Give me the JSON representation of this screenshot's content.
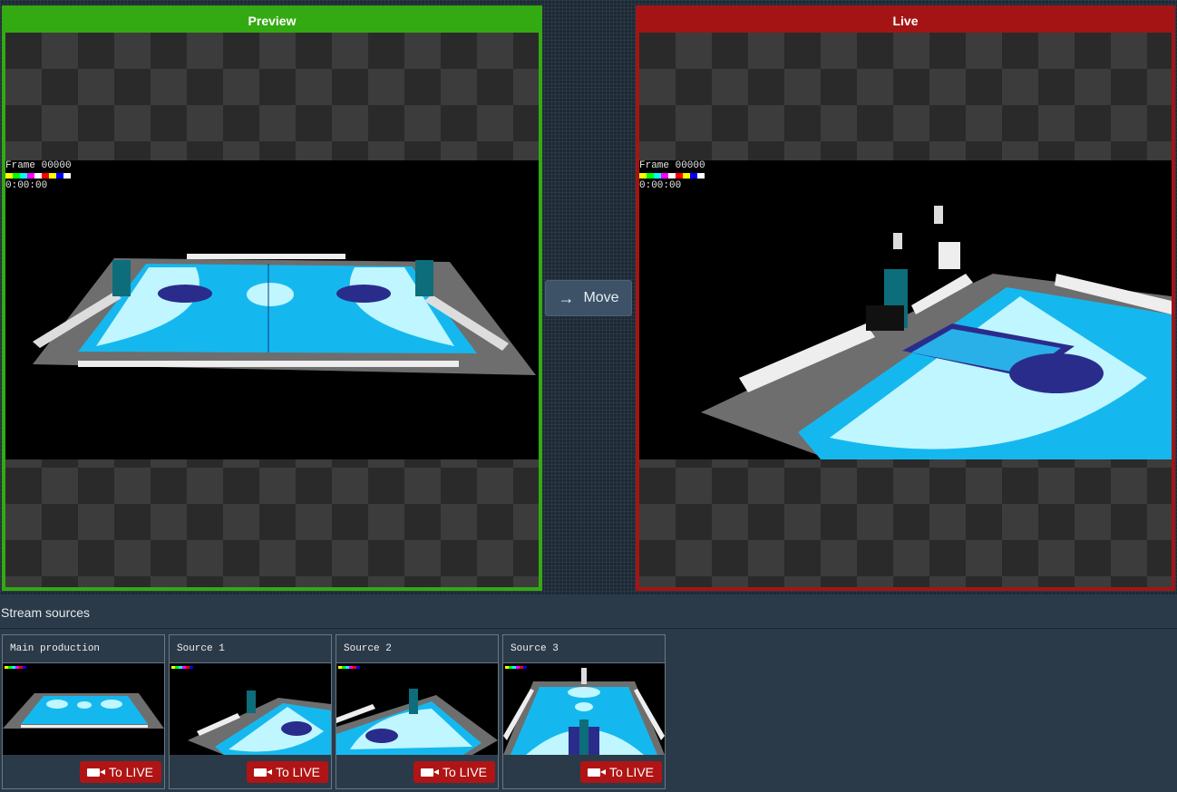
{
  "preview": {
    "label": "Preview",
    "frame_text": "Frame 00000",
    "timecode": "0:00:00"
  },
  "live": {
    "label": "Live",
    "frame_text": "Frame 00000",
    "timecode": "0:00:00"
  },
  "move_button": {
    "label": "Move",
    "icon": "arrow-right-icon"
  },
  "sources": {
    "title": "Stream sources",
    "items": [
      {
        "name": "Main production",
        "button": "To LIVE"
      },
      {
        "name": "Source 1",
        "button": "To LIVE"
      },
      {
        "name": "Source 2",
        "button": "To LIVE"
      },
      {
        "name": "Source 3",
        "button": "To LIVE"
      }
    ]
  },
  "colors": {
    "preview_border": "#33aa11",
    "live_border": "#a51414",
    "to_live_button": "#b01414",
    "court_blue": "#00ccff"
  }
}
